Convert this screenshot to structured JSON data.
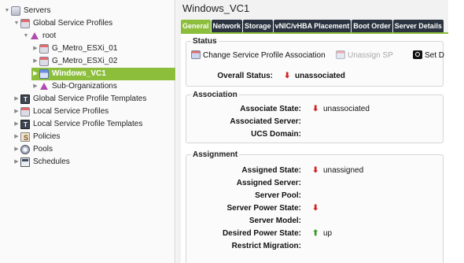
{
  "tree": {
    "servers": "Servers",
    "global_service_profiles": "Global Service Profiles",
    "root": "root",
    "profile_1": "G_Metro_ESXi_01",
    "profile_2": "G_Metro_ESXi_02",
    "selected_profile": "Windows_VC1",
    "sub_orgs": "Sub-Organizations",
    "global_templates": "Global Service Profile Templates",
    "local_profiles": "Local Service Profiles",
    "local_templates": "Local Service Profile Templates",
    "policies": "Policies",
    "pools": "Pools",
    "schedules": "Schedules"
  },
  "header": {
    "title": "Windows_VC1"
  },
  "tabs": [
    "General",
    "Network",
    "Storage",
    "vNIC/vHBA Placement",
    "Boot Order",
    "Server Details"
  ],
  "status": {
    "title": "Status",
    "change_assoc": "Change Service Profile Association",
    "unassign": "Unassign SP",
    "set_desired": "Set D",
    "overall_label": "Overall Status:",
    "overall_value": "unassociated"
  },
  "association": {
    "title": "Association",
    "associate_state_label": "Associate State:",
    "associate_state_value": "unassociated",
    "associated_server_label": "Associated Server:",
    "ucs_domain_label": "UCS Domain:"
  },
  "assignment": {
    "title": "Assignment",
    "assigned_state_label": "Assigned State:",
    "assigned_state_value": "unassigned",
    "assigned_server_label": "Assigned Server:",
    "server_pool_label": "Server Pool:",
    "server_power_state_label": "Server Power State:",
    "server_model_label": "Server Model:",
    "desired_power_state_label": "Desired Power State:",
    "desired_power_state_value": "up",
    "restrict_migration_label": "Restrict Migration:"
  },
  "colors": {
    "accent_green": "#8cbe3c",
    "tab_dark": "#2b3440",
    "status_down_red": "#d42020",
    "status_up_green": "#3b9a2c"
  },
  "icons": {
    "down_arrow": "⬇",
    "up_arrow": "⬆"
  }
}
